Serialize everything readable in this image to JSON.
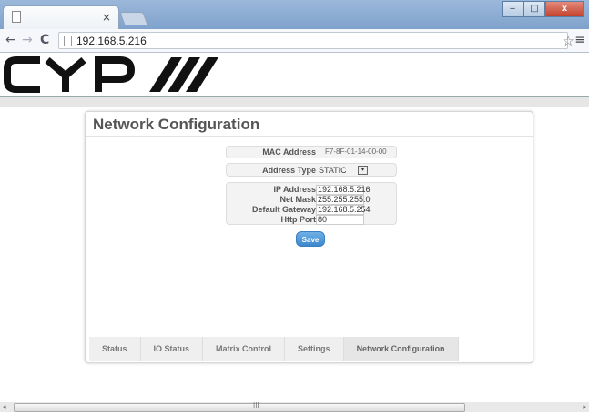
{
  "browser": {
    "tab_title": "",
    "tab_close": "×",
    "url": "192.168.5.216",
    "nav": {
      "back": "←",
      "forward": "→",
      "reload": "C"
    },
    "star": "☆",
    "menu": "≡",
    "window_buttons": {
      "minimize": "‒",
      "maximize": "□",
      "close": "x"
    }
  },
  "logo": {
    "text": "CYP"
  },
  "panel": {
    "title": "Network Configuration",
    "mac": {
      "label": "MAC Address",
      "value": "F7-8F-01-14-00-00"
    },
    "address_type": {
      "label": "Address Type",
      "value": "STATIC",
      "dropdown_icon": "▾"
    },
    "ip": {
      "label": "IP Address",
      "value": "192.168.5.216"
    },
    "netmask": {
      "label": "Net Mask",
      "value": "255.255.255.0"
    },
    "gateway": {
      "label": "Default Gateway",
      "value": "192.168.5.254"
    },
    "http_port": {
      "label": "Http Port",
      "value": "80"
    },
    "save_label": "Save"
  },
  "tabs": [
    {
      "label": "Status"
    },
    {
      "label": "IO Status"
    },
    {
      "label": "Matrix Control"
    },
    {
      "label": "Settings"
    },
    {
      "label": "Network Configuration"
    }
  ],
  "scrollbar": {
    "grip": "III",
    "left_arrow": "◂",
    "right_arrow": "▸"
  }
}
